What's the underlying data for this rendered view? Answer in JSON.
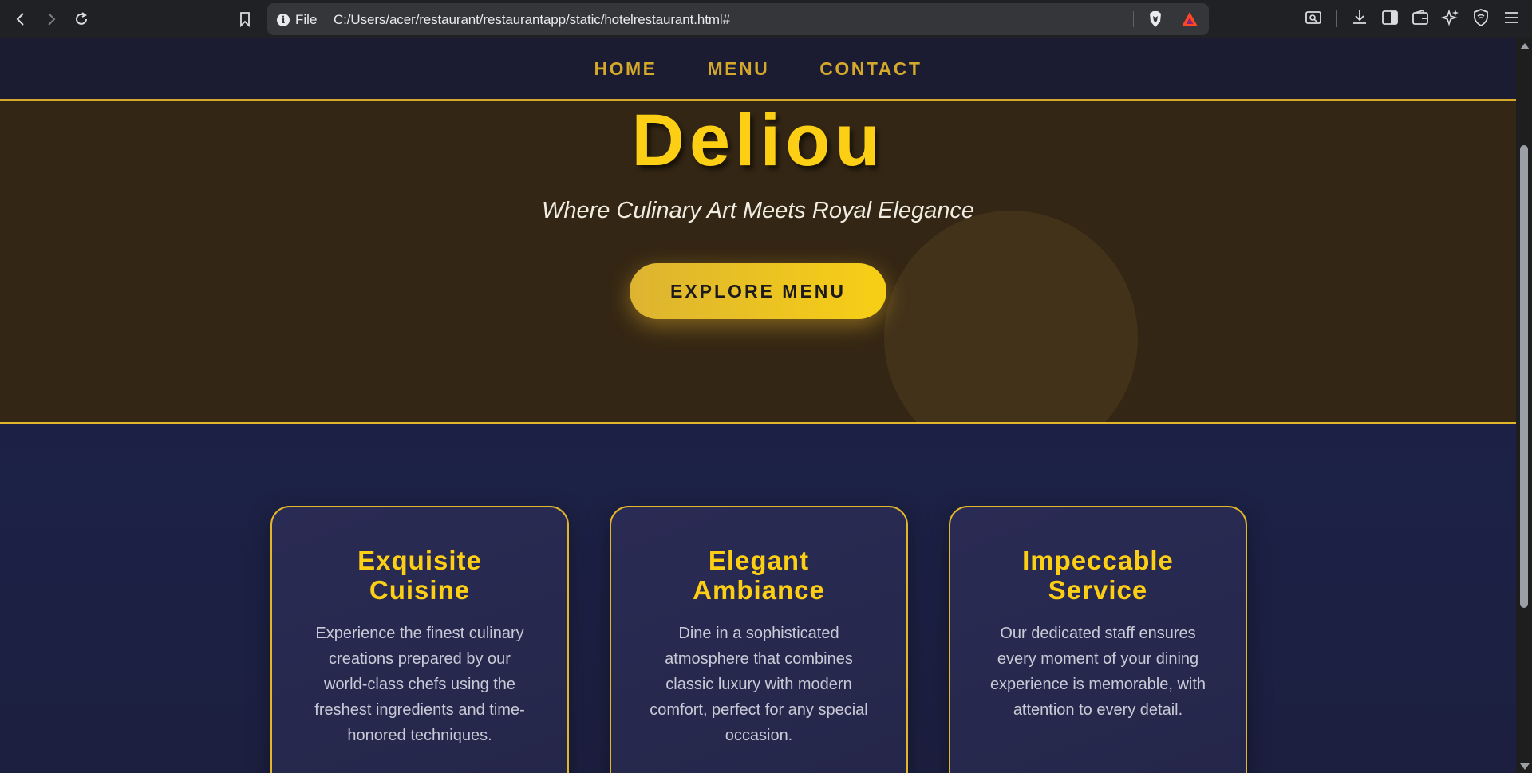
{
  "browser": {
    "file_label": "File",
    "url": "C:/Users/acer/restaurant/restaurantapp/static/hotelrestaurant.html#"
  },
  "nav": {
    "home": "HOME",
    "menu": "MENU",
    "contact": "CONTACT"
  },
  "hero": {
    "title": "Deliou",
    "tagline": "Where Culinary Art Meets Royal Elegance",
    "button": "EXPLORE MENU"
  },
  "features": [
    {
      "title": "Exquisite Cuisine",
      "text": "Experience the finest culinary creations prepared by our world-class chefs using the freshest ingredients and time-honored techniques."
    },
    {
      "title": "Elegant Ambiance",
      "text": "Dine in a sophisticated atmosphere that combines classic luxury with modern comfort, perfect for any special occasion."
    },
    {
      "title": "Impeccable Service",
      "text": "Our dedicated staff ensures every moment of your dining experience is memorable, with attention to every detail."
    }
  ],
  "colors": {
    "accent_gold": "#fccf15",
    "nav_gold": "#d4a82a",
    "hero_bg": "#342614",
    "page_bg": "#1c2146",
    "card_bg": "#2a2b54"
  }
}
